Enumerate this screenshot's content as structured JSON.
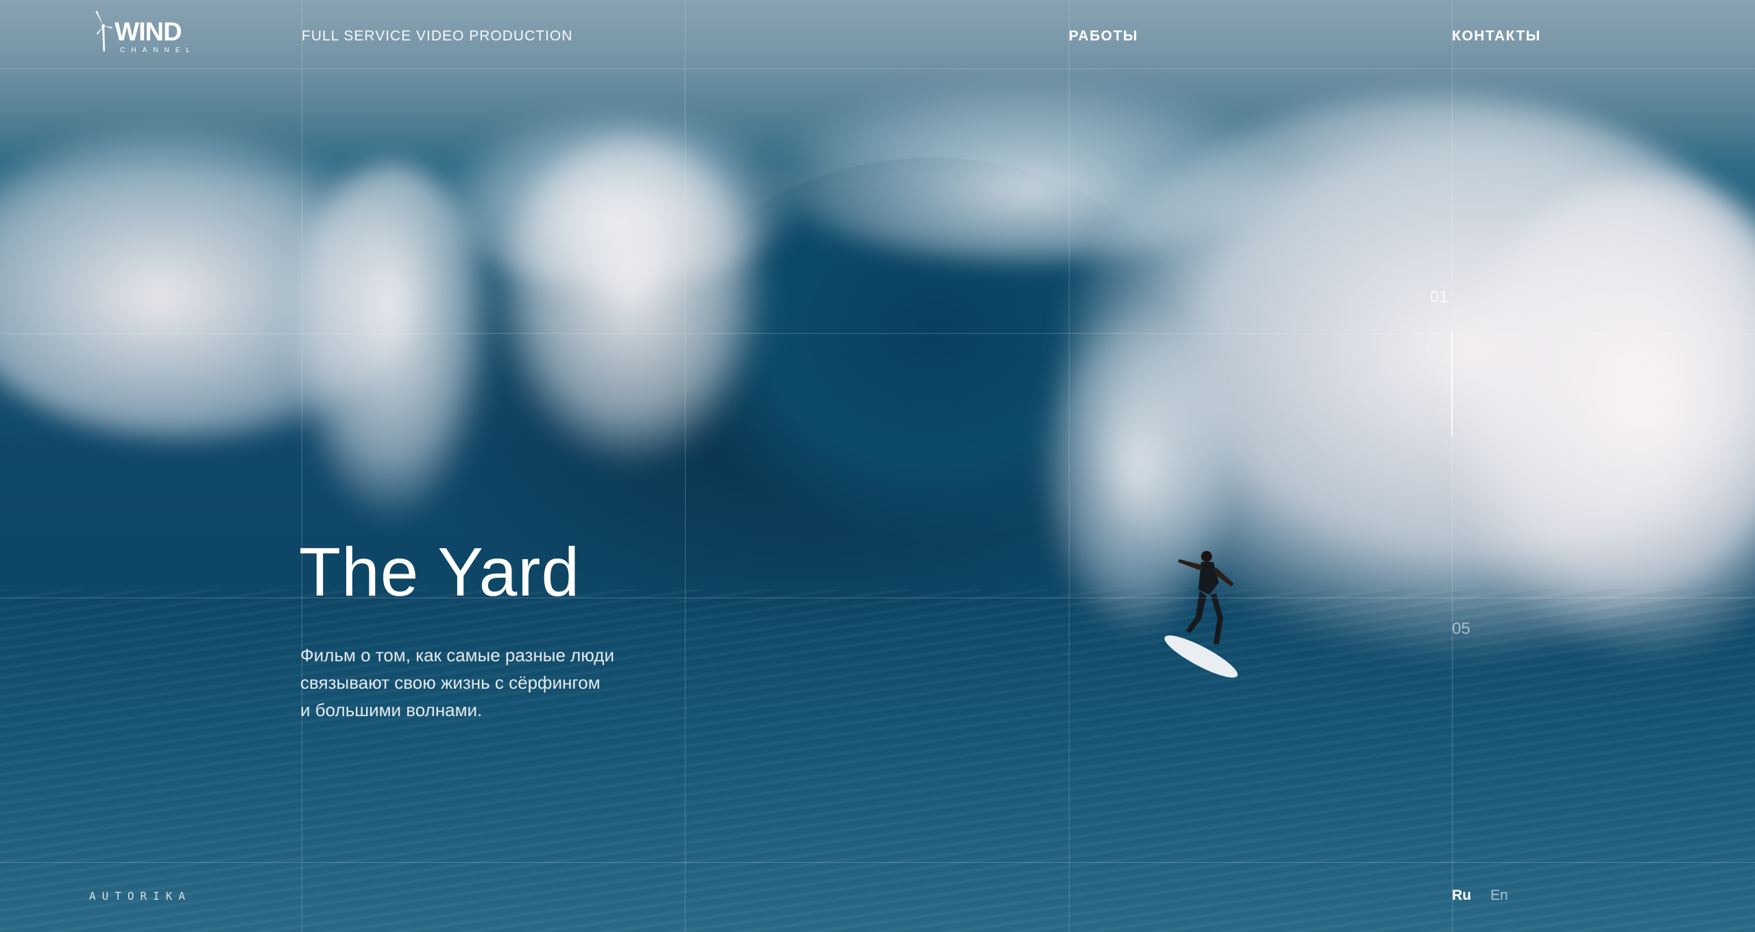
{
  "brand": {
    "logo_word": "WIND",
    "logo_sub": "CHANNEL",
    "tagline": "FULL SERVICE VIDEO PRODUCTION"
  },
  "nav": {
    "works": "РАБОТЫ",
    "contacts": "КОНТАКТЫ"
  },
  "hero": {
    "title": "The Yard",
    "description_lines": [
      "Фильм о том, как самые разные люди",
      "связывают свою жизнь с сёрфингом",
      "и большими волнами."
    ]
  },
  "slider": {
    "current": "01",
    "total": "05"
  },
  "footer": {
    "studio": "AUTORIKA",
    "languages": [
      {
        "label": "Ru",
        "active": true
      },
      {
        "label": "En",
        "active": false
      }
    ]
  },
  "colors": {
    "text": "#ffffff",
    "ocean_dark": "#0e4666",
    "foam": "#f5f0f2"
  },
  "icons": {
    "logo": "wind-turbine-icon"
  }
}
